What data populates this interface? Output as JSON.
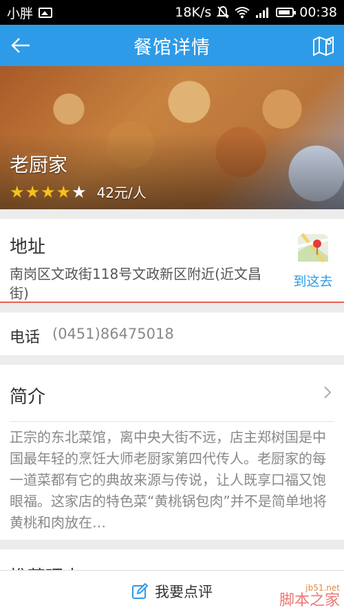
{
  "status_bar": {
    "carrier": "小胖",
    "speed": "18K/s",
    "time": "00:38"
  },
  "app_bar": {
    "title": "餐馆详情",
    "back_icon": "arrow-left-icon",
    "map_icon": "map-icon"
  },
  "restaurant": {
    "name": "老厨家",
    "rating": 4,
    "rating_max": 5,
    "price": "42元/人"
  },
  "address": {
    "heading": "地址",
    "text": "南岗区文政街118号文政新区附近(近文昌街)",
    "nav_label": "到这去"
  },
  "phone": {
    "label": "电话",
    "number": "(0451)86475018"
  },
  "intro": {
    "heading": "简介",
    "body": "正宗的东北菜馆，离中央大街不远，店主郑树国是中国最年轻的烹饪大师老厨家第四代传人。老厨家的每一道菜都有它的典故来源与传说，让人既享口福又饱眼福。这家店的特色菜“黄桃锅包肉”并不是简单地将黄桃和肉放在…"
  },
  "reason": {
    "heading": "推荐理由"
  },
  "bottom": {
    "review_label": "我要点评"
  },
  "watermark": {
    "line1": "jb51.net",
    "line2": "脚本之家"
  },
  "colors": {
    "primary": "#2e9be8",
    "star": "#f7c21a",
    "accent_line": "#e8604c"
  }
}
